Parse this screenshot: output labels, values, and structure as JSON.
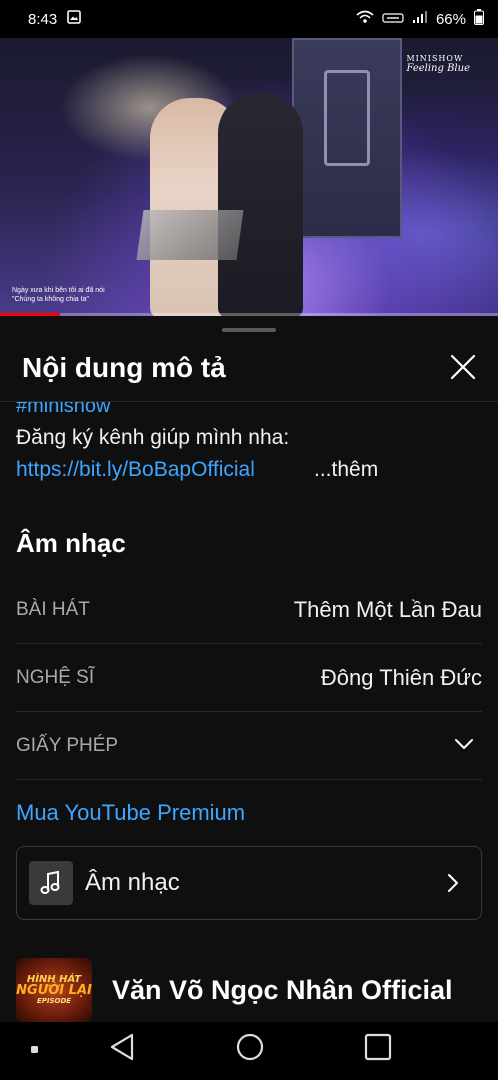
{
  "status_bar": {
    "time": "8:43",
    "battery": "66%"
  },
  "video": {
    "caption_line1": "Ngày xưa khi bên tôi ai đã nói",
    "caption_line2": "\"Chúng ta không chia ta\"",
    "watermark_line1": "MINISHOW",
    "watermark_line2": "Feeling Blue",
    "progress": 0.12
  },
  "sheet": {
    "title": "Nội dung mô tả",
    "hashtag": "#minishow",
    "description_line": "Đăng ký kênh giúp mình nha:",
    "link": "https://bit.ly/BoBapOfficial",
    "more": "...thêm",
    "music_title": "Âm nhạc",
    "rows": [
      {
        "label": "BÀI HÁT",
        "value": "Thêm Một Lần Đau"
      },
      {
        "label": "NGHỆ SĨ",
        "value": "Đông Thiên Đức"
      },
      {
        "label": "GIẤY PHÉP",
        "value": ""
      }
    ],
    "premium_link": "Mua YouTube Premium",
    "music_card_label": "Âm nhạc",
    "channel_logo_line1": "HÌNH HÁT",
    "channel_logo_line2": "NGƯỜI LẠI",
    "channel_logo_line3": "EPISODE",
    "channel_name": "Văn Võ Ngọc Nhân Official"
  },
  "colors": {
    "background": "#0f0f0f",
    "link": "#3ea6ff",
    "progress": "#ff0000"
  }
}
